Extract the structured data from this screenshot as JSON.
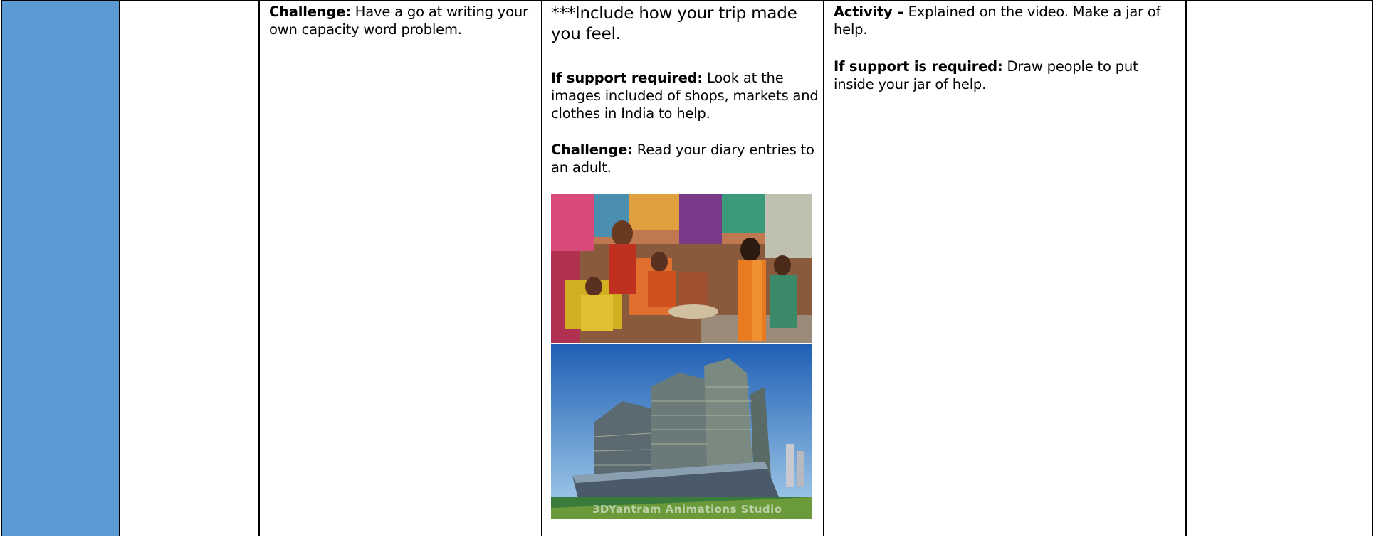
{
  "col2": {
    "challenge_label": "Challenge:",
    "challenge_text": " Have a go at writing your own capacity word problem."
  },
  "col3": {
    "include_text": "***Include how your trip made you feel.",
    "support_label": "If support required:",
    "support_text": " Look at the images included of shops, markets and clothes in India to help.",
    "challenge_label": "Challenge:",
    "challenge_text": " Read your diary entries to an adult.",
    "image_market": "market-photo",
    "image_building": "building-render",
    "image_caption": "3DYantram Animations Studio"
  },
  "col4": {
    "activity_label": "Activity –",
    "activity_text": " Explained on the video. Make a jar of help.",
    "support_label": "If support is required:",
    "support_text": " Draw people to put inside your jar of help."
  },
  "colors": {
    "blue_column": "#5b9bd5"
  }
}
